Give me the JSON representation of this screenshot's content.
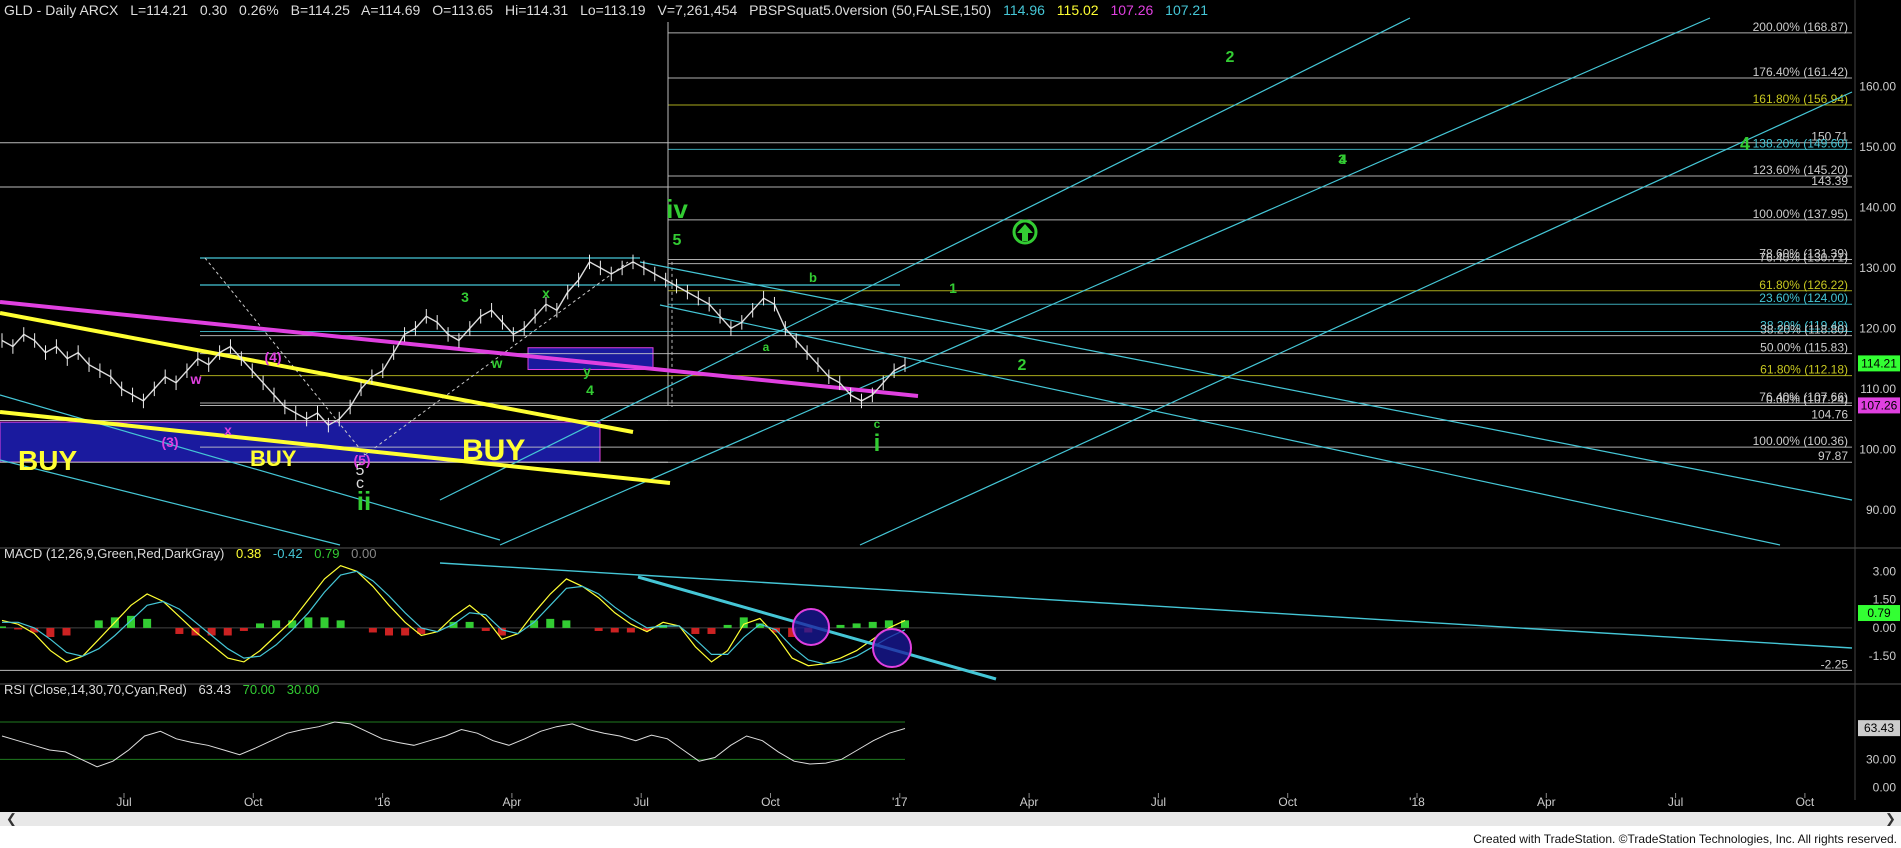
{
  "header": {
    "symbol": "GLD - Daily  ARCX",
    "last": "L=114.21",
    "change": "0.30",
    "pct": "0.26%",
    "bid": "B=114.25",
    "ask": "A=114.69",
    "open": "O=113.65",
    "high": "Hi=114.31",
    "low": "Lo=113.19",
    "volume": "V=7,261,454",
    "study": "PBSPSquat5.0version (50,FALSE,150)",
    "study_values": [
      "114.96",
      "115.02",
      "107.26",
      "107.21"
    ]
  },
  "macd_header": {
    "label": "MACD (12,26,9,Green,Red,DarkGray)",
    "v1": "0.38",
    "v2": "-0.42",
    "v3": "0.79",
    "v4": "0.00"
  },
  "rsi_header": {
    "label": "RSI (Close,14,30,70,Cyan,Red)",
    "v1": "63.43",
    "v2": "70.00",
    "v3": "30.00"
  },
  "footer": "Created with TradeStation. ©TradeStation Technologies, Inc. All rights reserved.",
  "colors": {
    "bg": "#000000",
    "cyan": "#45c6d6",
    "yellow": "#ffff33",
    "magenta": "#e040e0",
    "green": "#33cc33",
    "blue": "#1a1a9e",
    "price_label": "#33ff33"
  },
  "chart_data": [
    {
      "type": "line",
      "panel": "price",
      "y_ticks": [
        "160.00",
        "150.00",
        "140.00",
        "130.00",
        "120.00",
        "110.00",
        "100.00",
        "90.00"
      ],
      "ylim": [
        85,
        172
      ],
      "x_ticks": [
        "Jul",
        "Oct",
        "'16",
        "Apr",
        "Jul",
        "Oct",
        "'17",
        "Apr",
        "Jul",
        "Oct",
        "'18",
        "Apr",
        "Jul",
        "Oct"
      ],
      "right_labels": [
        {
          "text": "114.21",
          "value": 114.21,
          "bg": "#33ff33",
          "fg": "#000"
        },
        {
          "text": "107.26",
          "value": 107.26,
          "bg": "#e040e0",
          "fg": "#000"
        }
      ],
      "fib_levels": [
        {
          "text": "200.00% (168.87)",
          "value": 168.87,
          "color": "#cccccc"
        },
        {
          "text": "176.40% (161.42)",
          "value": 161.42,
          "color": "#cccccc"
        },
        {
          "text": "161.80% (156.94)",
          "value": 156.94,
          "color": "#c8c820"
        },
        {
          "text": "150.71",
          "value": 150.71,
          "color": "#cccccc"
        },
        {
          "text": "138.20% (149.60)",
          "value": 149.6,
          "color": "#45c6d6"
        },
        {
          "text": "123.60% (145.20)",
          "value": 145.2,
          "color": "#cccccc"
        },
        {
          "text": "143.39",
          "value": 143.39,
          "color": "#cccccc"
        },
        {
          "text": "100.00% (137.95)",
          "value": 137.95,
          "color": "#cccccc"
        },
        {
          "text": "78.60% (131.39)",
          "value": 131.39,
          "color": "#cccccc"
        },
        {
          "text": "76.40% (130.71)",
          "value": 130.71,
          "color": "#cccccc"
        },
        {
          "text": "61.80% (126.22)",
          "value": 126.22,
          "color": "#c8c820"
        },
        {
          "text": "23.60% (124.00)",
          "value": 124.0,
          "color": "#45c6d6"
        },
        {
          "text": "38.20% (119.48)",
          "value": 119.48,
          "color": "#45c6d6"
        },
        {
          "text": "38.20% (118.80)",
          "value": 118.8,
          "color": "#cccccc"
        },
        {
          "text": "50.00% (115.83)",
          "value": 115.83,
          "color": "#cccccc"
        },
        {
          "text": "61.80% (112.18)",
          "value": 112.18,
          "color": "#c8c820"
        },
        {
          "text": "76.40% (107.66)",
          "value": 107.66,
          "color": "#cccccc"
        },
        {
          "text": "0.00% (107.24)",
          "value": 107.24,
          "color": "#cccccc"
        },
        {
          "text": "104.76",
          "value": 104.76,
          "color": "#cccccc"
        },
        {
          "text": "100.00% (100.36)",
          "value": 100.36,
          "color": "#cccccc"
        },
        {
          "text": "97.87",
          "value": 97.87,
          "color": "#cccccc"
        }
      ],
      "buy_labels": [
        "BUY",
        "BUY",
        "BUY"
      ],
      "wave_labels": {
        "white": [
          "5",
          "c"
        ],
        "magenta": [
          "(3)",
          "(4)",
          "(5)",
          "w",
          "x"
        ],
        "green": [
          "3",
          "x",
          "w",
          "y",
          "4",
          "5",
          "b",
          "a",
          "c",
          "2",
          "4",
          "1",
          "2",
          "3",
          "4",
          "iv",
          "i",
          "ii"
        ]
      },
      "series": [
        {
          "name": "GLD Daily",
          "values": [
            118,
            117,
            119,
            118,
            116,
            117,
            115,
            116,
            114,
            113,
            112,
            110,
            109,
            108,
            110,
            112,
            111,
            113,
            115,
            114,
            116,
            117,
            115,
            113,
            111,
            109,
            107,
            106,
            105,
            106,
            104,
            105,
            107,
            110,
            112,
            113,
            116,
            119,
            120,
            122,
            121,
            119,
            118,
            120,
            122,
            123,
            121,
            119,
            120,
            122,
            124,
            123,
            126,
            128,
            131,
            130,
            129,
            130,
            131,
            130,
            129,
            128,
            127,
            126,
            125,
            124,
            122,
            120,
            121,
            123,
            125,
            124,
            120,
            118,
            116,
            114,
            112,
            111,
            109,
            108,
            109,
            111,
            113,
            114
          ]
        }
      ]
    },
    {
      "type": "line",
      "panel": "macd",
      "y_ticks": [
        "3.00",
        "1.50",
        "0.00",
        "-1.50"
      ],
      "ylim": [
        -2.6,
        3.6
      ],
      "right_labels": [
        {
          "text": "0.79",
          "value": 0.79,
          "bg": "#33ff33",
          "fg": "#000"
        }
      ],
      "ref_label": "-2.25",
      "series": [
        {
          "name": "MACD",
          "values": [
            0.4,
            0.2,
            -0.3,
            -1.2,
            -1.8,
            -1.5,
            -0.6,
            0.3,
            1.2,
            1.8,
            1.4,
            0.6,
            -0.2,
            -0.9,
            -1.6,
            -1.8,
            -1.2,
            -0.4,
            0.4,
            1.5,
            2.6,
            3.3,
            3.0,
            2.2,
            1.2,
            0.3,
            -0.4,
            -0.2,
            0.6,
            1.2,
            0.5,
            -0.6,
            -0.3,
            0.8,
            1.8,
            2.6,
            2.2,
            1.6,
            0.8,
            0.2,
            -0.2,
            0.3,
            0.1,
            -1.0,
            -1.8,
            -1.2,
            0.2,
            0.5,
            -0.4,
            -1.6,
            -2.0,
            -1.9,
            -1.6,
            -1.2,
            -0.6,
            0.0,
            0.4
          ]
        },
        {
          "name": "Signal",
          "values": [
            0.3,
            0.3,
            0.0,
            -0.6,
            -1.3,
            -1.5,
            -1.1,
            -0.4,
            0.4,
            1.2,
            1.4,
            1.0,
            0.3,
            -0.4,
            -1.1,
            -1.6,
            -1.5,
            -0.9,
            -0.1,
            0.8,
            1.9,
            2.8,
            3.0,
            2.5,
            1.7,
            0.8,
            0.0,
            -0.2,
            0.2,
            0.8,
            0.7,
            -0.1,
            -0.3,
            0.3,
            1.2,
            2.1,
            2.2,
            1.8,
            1.1,
            0.5,
            0.0,
            0.1,
            0.1,
            -0.6,
            -1.4,
            -1.4,
            -0.5,
            0.2,
            -0.1,
            -1.0,
            -1.7,
            -1.9,
            -1.8,
            -1.5,
            -1.0,
            -0.5,
            -0.1
          ]
        }
      ]
    },
    {
      "type": "line",
      "panel": "rsi",
      "y_ticks": [
        "60.00",
        "30.00",
        "0.00"
      ],
      "ylim": [
        -5,
        100
      ],
      "right_labels": [
        {
          "text": "63.43",
          "value": 63.43,
          "bg": "#cccccc",
          "fg": "#000"
        }
      ],
      "series": [
        {
          "name": "RSI",
          "values": [
            55,
            50,
            45,
            40,
            38,
            30,
            22,
            28,
            40,
            55,
            60,
            52,
            48,
            45,
            40,
            35,
            42,
            50,
            58,
            62,
            65,
            70,
            68,
            60,
            52,
            48,
            45,
            50,
            55,
            62,
            58,
            50,
            45,
            52,
            60,
            65,
            68,
            62,
            58,
            55,
            50,
            56,
            52,
            40,
            28,
            32,
            45,
            55,
            50,
            38,
            28,
            25,
            26,
            30,
            40,
            50,
            58,
            63
          ]
        }
      ]
    }
  ]
}
